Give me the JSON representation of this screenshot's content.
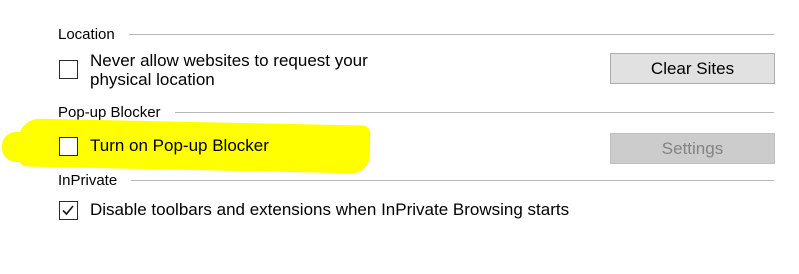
{
  "location": {
    "title": "Location",
    "never_allow_label_line1": "Never allow websites to request your",
    "never_allow_label_line2": "physical location",
    "never_allow_checked": false,
    "clear_sites_button": "Clear Sites"
  },
  "popup": {
    "title": "Pop-up Blocker",
    "turn_on_label": "Turn on Pop-up Blocker",
    "turn_on_checked": false,
    "settings_button": "Settings",
    "settings_disabled": true
  },
  "inprivate": {
    "title": "InPrivate",
    "disable_toolbars_label": "Disable toolbars and extensions when InPrivate Browsing starts",
    "disable_toolbars_checked": true
  },
  "colors": {
    "highlight": "#ffff00",
    "button_bg": "#e1e1e1",
    "button_disabled_bg": "#cccccc",
    "button_disabled_text": "#838383"
  }
}
